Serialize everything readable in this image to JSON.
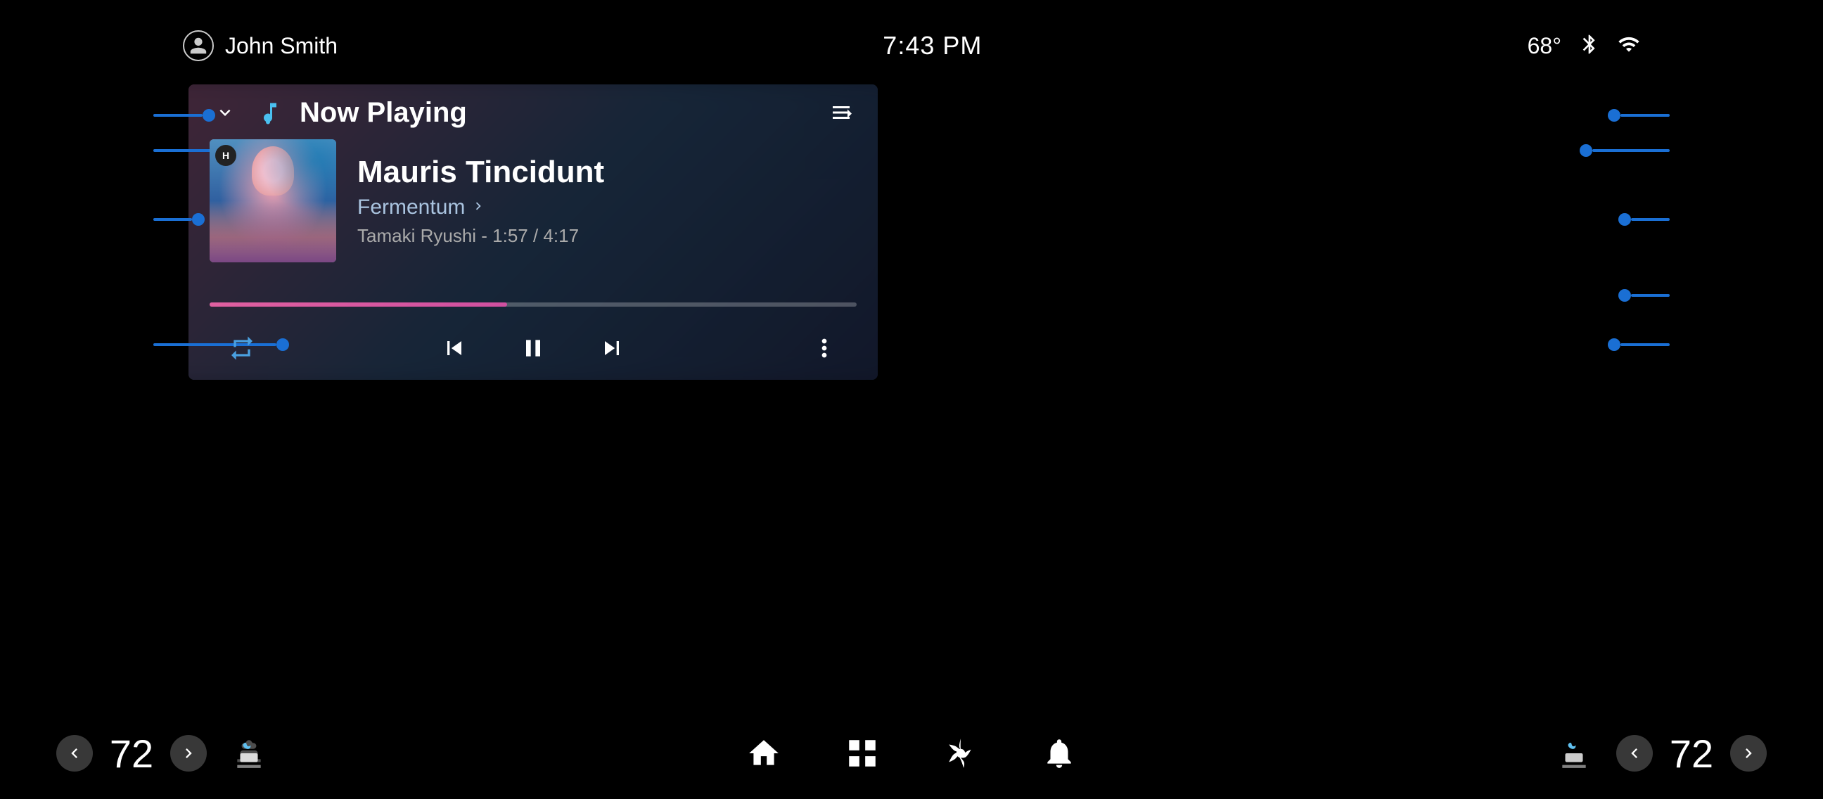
{
  "status": {
    "username": "John Smith",
    "time": "7:43 PM",
    "temperature": "68°",
    "bluetooth": "bluetooth",
    "signal": "signal"
  },
  "player": {
    "title": "Now Playing",
    "song_title": "Mauris Tincidunt",
    "album": "Fermentum",
    "artist_time": "Tamaki Ryushi - 1:57 / 4:17",
    "progress_percent": 46,
    "repeat_label": "repeat",
    "prev_label": "previous",
    "pause_label": "pause",
    "next_label": "next",
    "more_label": "more"
  },
  "bottom": {
    "left_temp": "72",
    "right_temp": "72",
    "left_heat_icon": "heat-left",
    "right_heat_icon": "heat-right",
    "home_icon": "home",
    "grid_icon": "grid",
    "fan_icon": "fan",
    "notification_icon": "notification"
  }
}
